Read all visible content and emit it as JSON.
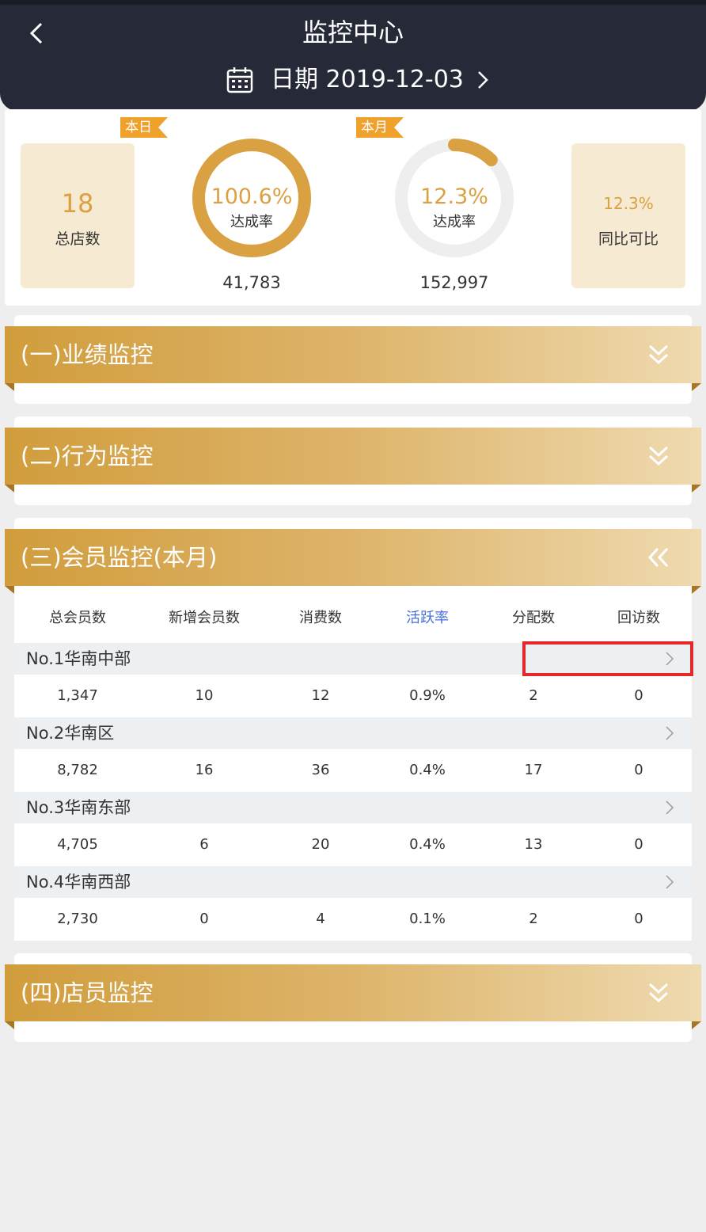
{
  "header": {
    "title": "监控中心",
    "date_label": "日期 2019-12-03"
  },
  "stats": {
    "store_count": {
      "value": "18",
      "label": "总店数"
    },
    "daily": {
      "tag": "本日",
      "percent": "100.6%",
      "label": "达成率",
      "total": "41,783",
      "progress": 1.0
    },
    "monthly": {
      "tag": "本月",
      "percent": "12.3%",
      "label": "达成率",
      "total": "152,997",
      "progress": 0.123
    },
    "yoy": {
      "value": "12.3%",
      "label": "同比可比"
    }
  },
  "sections": [
    {
      "title": "(一)业绩监控",
      "icon": "double-chevron-down-icon"
    },
    {
      "title": "(二)行为监控",
      "icon": "double-chevron-down-icon"
    },
    {
      "title": "(三)会员监控(本月)",
      "icon": "double-chevron-left-icon"
    },
    {
      "title": "(四)店员监控",
      "icon": "double-chevron-down-icon"
    }
  ],
  "member_table": {
    "columns": [
      "总会员数",
      "新增会员数",
      "消费数",
      "活跃率",
      "分配数",
      "回访数"
    ],
    "active_column": "活跃率",
    "groups": [
      {
        "name": "No.1华南中部",
        "values": [
          "1,347",
          "10",
          "12",
          "0.9%",
          "2",
          "0"
        ]
      },
      {
        "name": "No.2华南区",
        "values": [
          "8,782",
          "16",
          "36",
          "0.4%",
          "17",
          "0"
        ]
      },
      {
        "name": "No.3华南东部",
        "values": [
          "4,705",
          "6",
          "20",
          "0.4%",
          "13",
          "0"
        ]
      },
      {
        "name": "No.4华南西部",
        "values": [
          "2,730",
          "0",
          "4",
          "0.1%",
          "2",
          "0"
        ]
      }
    ]
  },
  "colors": {
    "header_bg": "#262937",
    "accent_gold": "#d9a142",
    "tag_orange": "#f0a12c",
    "active_blue": "#4a6fd8",
    "highlight_red": "#e5282a"
  }
}
